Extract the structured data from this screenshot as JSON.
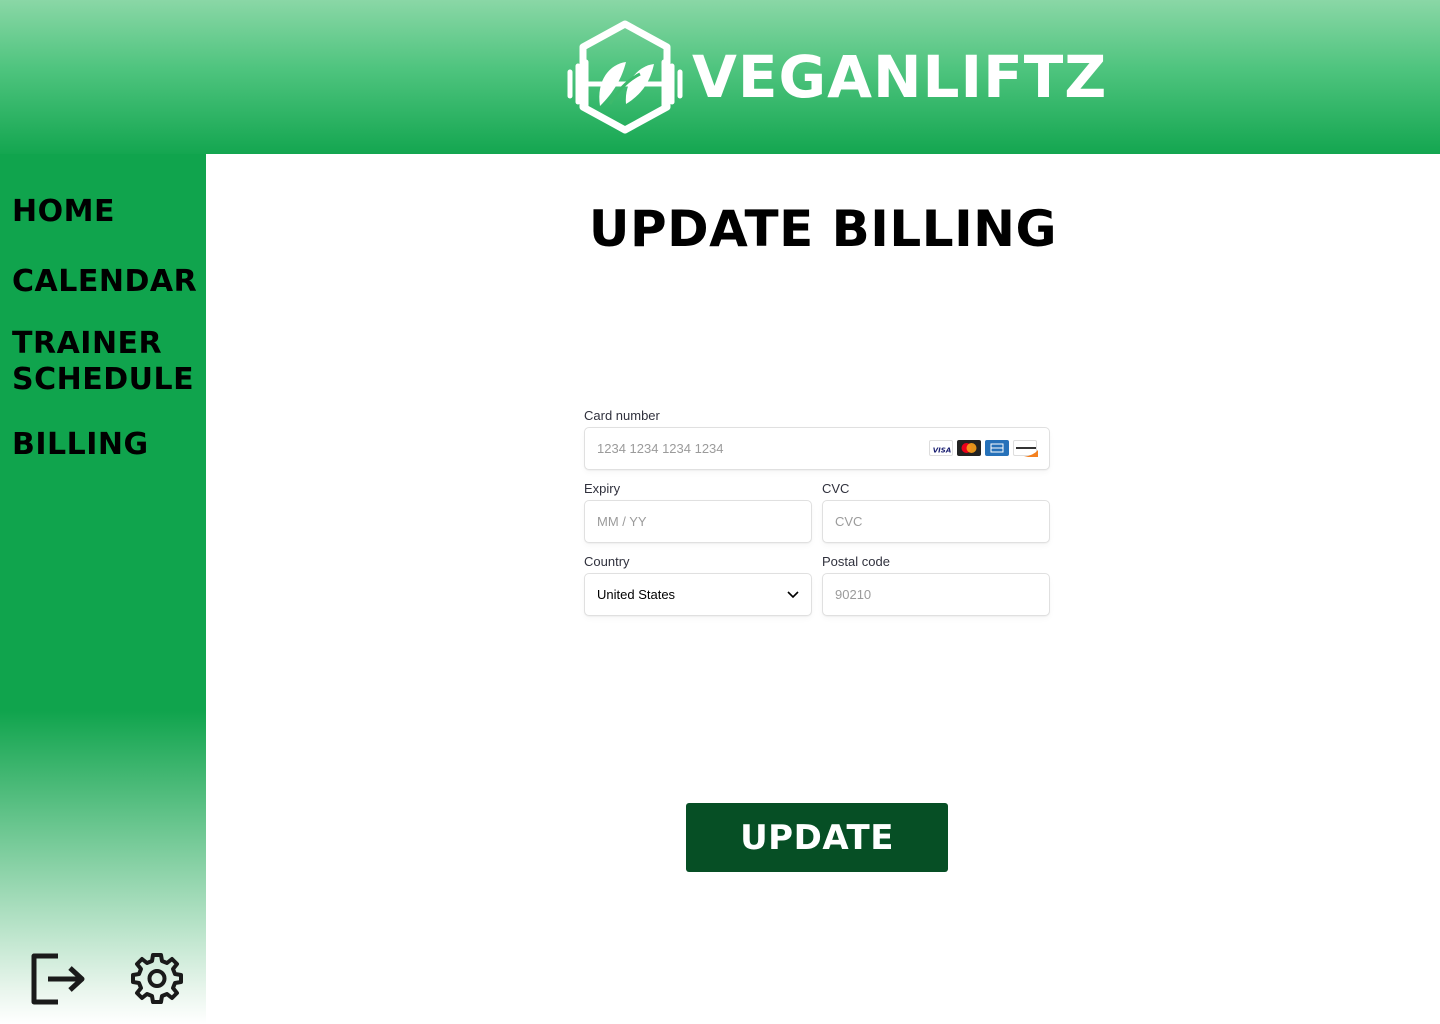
{
  "brand": {
    "name": "VEGANLIFTZ",
    "logo_icon": "barbell-leaf-hexagon-icon"
  },
  "sidebar": {
    "items": [
      {
        "label": "HOME"
      },
      {
        "label": "CALENDAR"
      },
      {
        "label": "TRAINER SCHEDULE"
      },
      {
        "label": "BILLING"
      }
    ],
    "bottom_icons": [
      "logout-icon",
      "settings-icon"
    ]
  },
  "main": {
    "title": "UPDATE BILLING",
    "form": {
      "card_number": {
        "label": "Card number",
        "placeholder": "1234 1234 1234 1234",
        "brands": [
          "visa",
          "mastercard",
          "amex",
          "discover"
        ]
      },
      "expiry": {
        "label": "Expiry",
        "placeholder": "MM / YY"
      },
      "cvc": {
        "label": "CVC",
        "placeholder": "CVC"
      },
      "country": {
        "label": "Country",
        "value": "United States"
      },
      "postal_code": {
        "label": "Postal code",
        "placeholder": "90210"
      }
    },
    "submit_label": "UPDATE"
  },
  "colors": {
    "header_top": "#8ad7a6",
    "brand_green": "#10a44d",
    "button_dark_green": "#064f25"
  }
}
